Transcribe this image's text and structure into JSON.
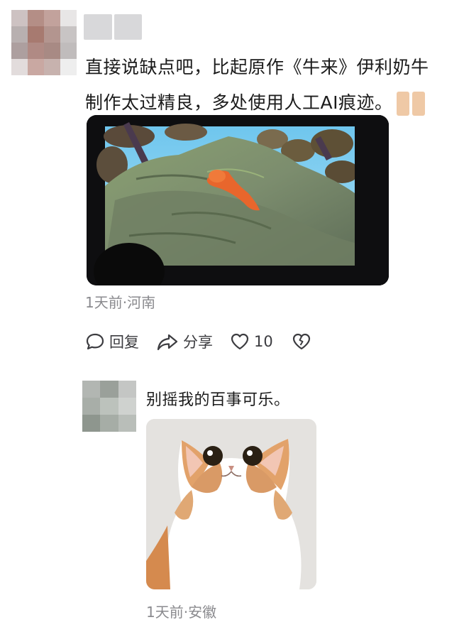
{
  "comment": {
    "text_line1": "直接说缺点吧，比起原作《牛来》伊利奶牛",
    "text_line2": "制作太过精良，多处使用人工AI痕迹。",
    "sticker_icon": "emoji-sticker-icon",
    "meta": "1天前·河南",
    "actions": {
      "reply_label": "回复",
      "share_label": "分享",
      "like_count": "10"
    }
  },
  "reply": {
    "text": "别摇我的百事可乐。",
    "meta": "1天前·安徽"
  },
  "colors": {
    "avatar_main": [
      "#cdc2c2",
      "#b48e86",
      "#c2a29c",
      "#e8e6e6",
      "#b8b0b0",
      "#a77a70",
      "#b3958f",
      "#c8c4c4",
      "#ad9f9f",
      "#b08a84",
      "#a88a84",
      "#c0bcbc",
      "#e2dcdc",
      "#c9a8a2",
      "#c7b2ae",
      "#eeeeee"
    ],
    "avatar_reply": [
      "#b2b6b2",
      "#9aa09a",
      "#c4c6c4",
      "#a8aea8",
      "#bcc2bc",
      "#cfd2cf",
      "#8e968e",
      "#a6ada6",
      "#b9beb9"
    ]
  }
}
